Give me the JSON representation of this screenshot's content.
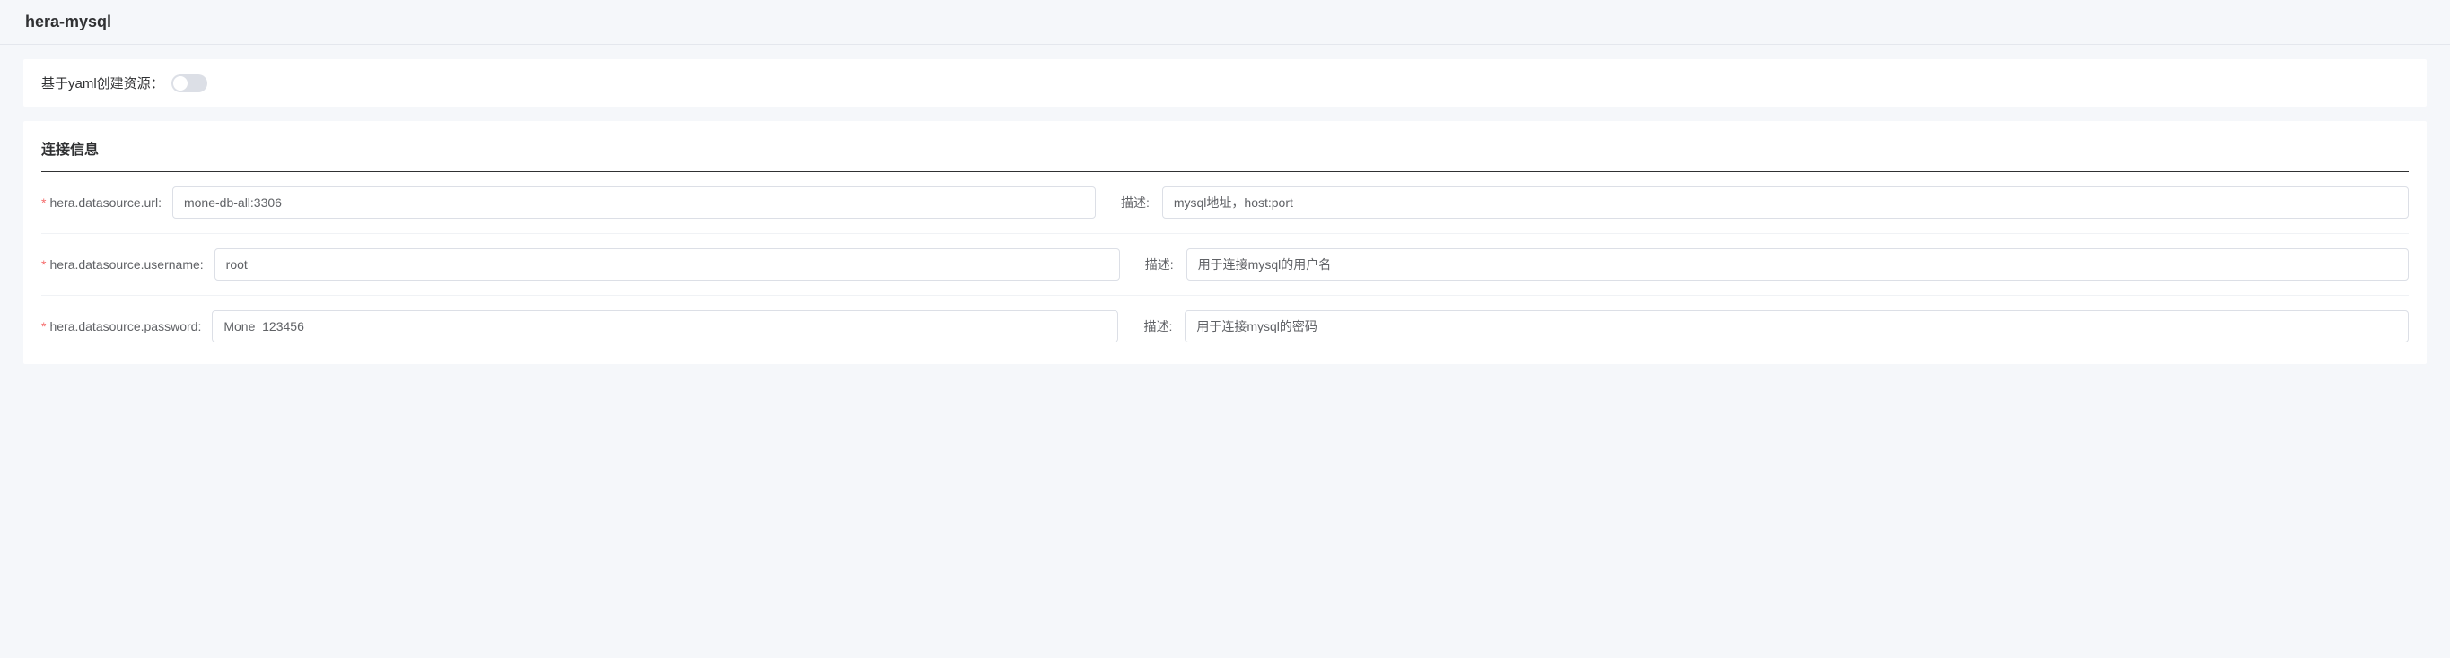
{
  "header": {
    "title": "hera-mysql"
  },
  "yaml": {
    "label": "基于yaml创建资源："
  },
  "section": {
    "title": "连接信息",
    "desc_label": "描述:",
    "fields": [
      {
        "label": "hera.datasource.url:",
        "required": true,
        "value": "mone-db-all:3306",
        "description": "mysql地址，host:port"
      },
      {
        "label": "hera.datasource.username:",
        "required": true,
        "value": "root",
        "description": "用于连接mysql的用户名"
      },
      {
        "label": "hera.datasource.password:",
        "required": true,
        "value": "Mone_123456",
        "description": "用于连接mysql的密码"
      }
    ]
  }
}
